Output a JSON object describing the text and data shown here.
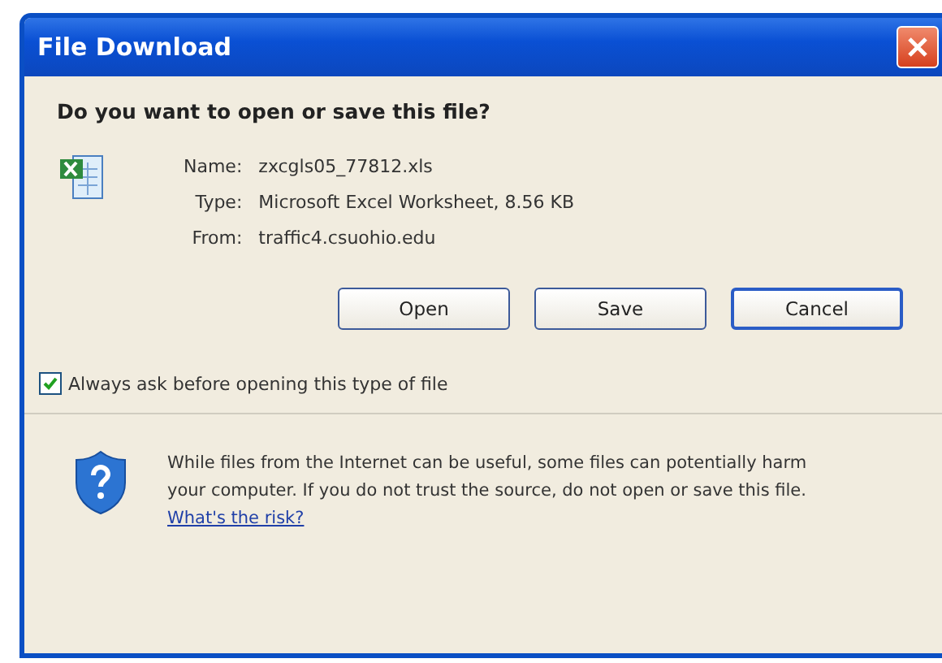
{
  "window": {
    "title": "File Download"
  },
  "question": "Do you want to open or save this file?",
  "details": [
    {
      "label": "Name:",
      "value": "zxcgls05_77812.xls"
    },
    {
      "label": "Type:",
      "value": "Microsoft Excel Worksheet, 8.56 KB"
    },
    {
      "label": "From:",
      "value": "traffic4.csuohio.edu"
    }
  ],
  "buttons": [
    {
      "label": "Open",
      "focused": false
    },
    {
      "label": "Save",
      "focused": false
    },
    {
      "label": "Cancel",
      "focused": true
    }
  ],
  "always_ask": {
    "label": "Always ask before opening this type of file",
    "checked": true
  },
  "warning": {
    "text": "While files from the Internet can be useful, some files can potentially harm your computer. If you do not trust the source, do not open or save this file.",
    "link": "What's the risk?"
  }
}
